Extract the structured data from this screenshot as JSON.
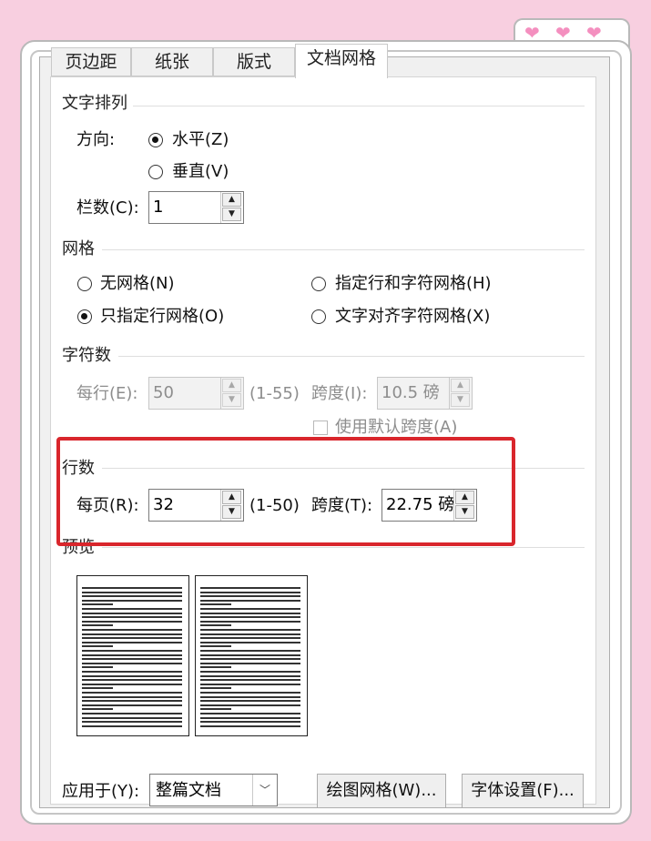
{
  "tabs": [
    "页边距",
    "纸张",
    "版式",
    "文档网格"
  ],
  "text_arrangement": {
    "title": "文字排列",
    "direction_label": "方向:",
    "direction_options": [
      {
        "label": "水平(Z)",
        "selected": true
      },
      {
        "label": "垂直(V)",
        "selected": false
      }
    ],
    "columns_label": "栏数(C):",
    "columns_value": "1"
  },
  "grid": {
    "title": "网格",
    "options": [
      {
        "label": "无网格(N)",
        "selected": false
      },
      {
        "label": "指定行和字符网格(H)",
        "selected": false
      },
      {
        "label": "只指定行网格(O)",
        "selected": true
      },
      {
        "label": "文字对齐字符网格(X)",
        "selected": false
      }
    ]
  },
  "characters": {
    "title": "字符数",
    "per_line_label": "每行(E):",
    "per_line_value": "50",
    "per_line_range": "(1-55)",
    "pitch_label": "跨度(I):",
    "pitch_value": "10.5 磅",
    "default_pitch_label": "使用默认跨度(A)"
  },
  "lines": {
    "title": "行数",
    "per_page_label": "每页(R):",
    "per_page_value": "32",
    "per_page_range": "(1-50)",
    "pitch_label": "跨度(T):",
    "pitch_value": "22.75 磅"
  },
  "preview": {
    "title": "预览"
  },
  "footer": {
    "apply_label": "应用于(Y):",
    "apply_value": "整篇文档",
    "draw_grid_button": "绘图网格(W)...",
    "font_settings_button": "字体设置(F)..."
  },
  "colors": {
    "highlight": "#d9262c",
    "hearts": "#f48fbf",
    "background": "#f8cfe0"
  }
}
